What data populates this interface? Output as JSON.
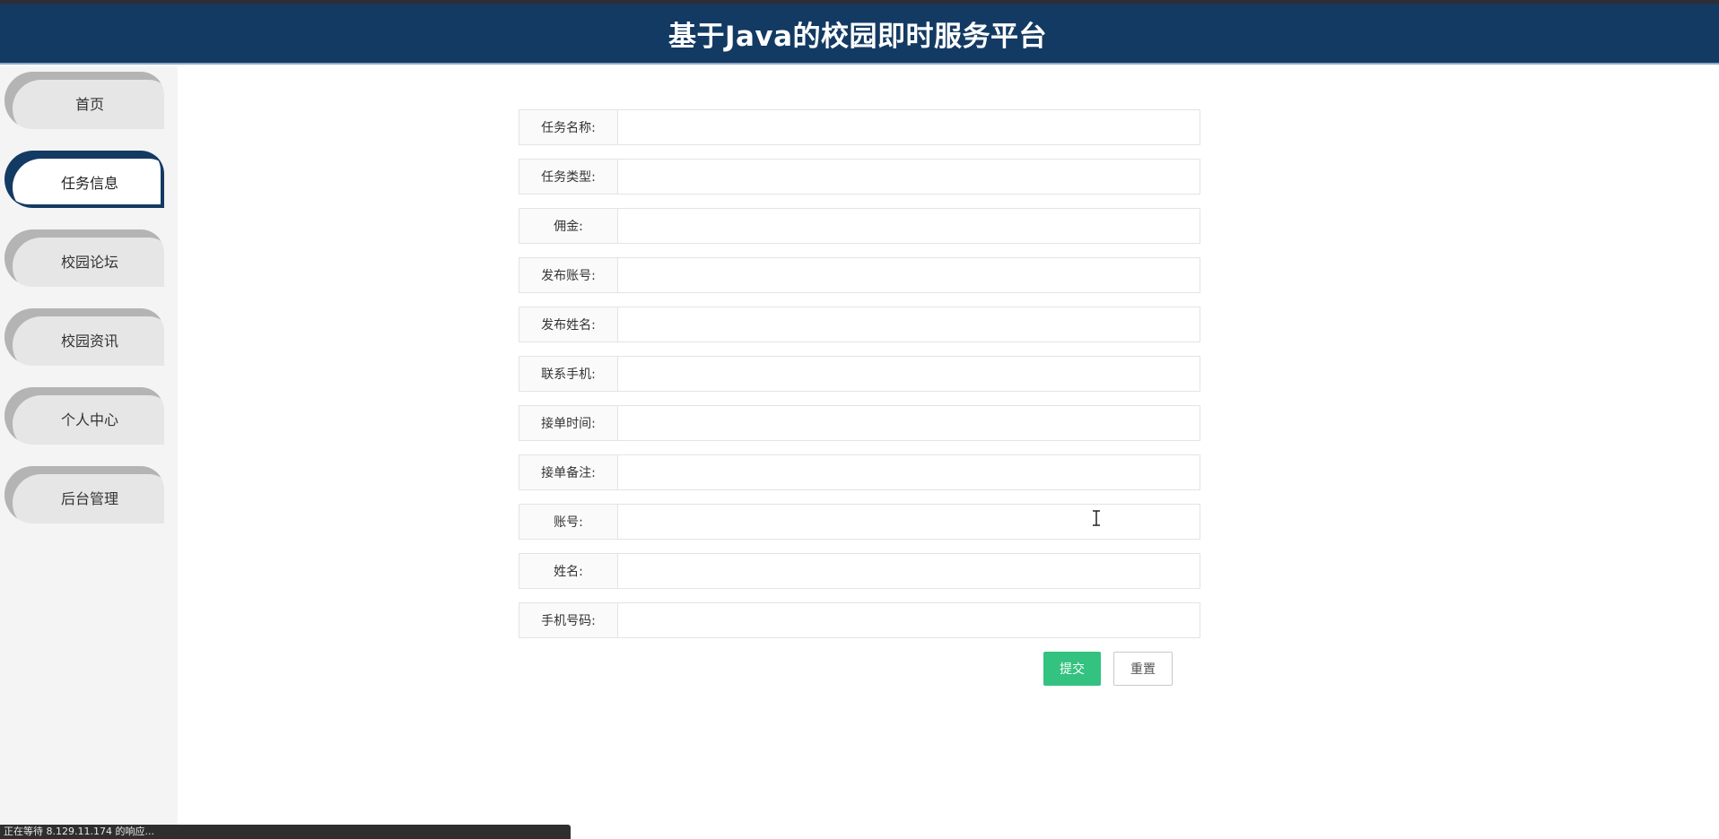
{
  "header": {
    "title": "基于Java的校园即时服务平台"
  },
  "sidebar": {
    "items": [
      {
        "label": "首页"
      },
      {
        "label": "任务信息"
      },
      {
        "label": "校园论坛"
      },
      {
        "label": "校园资讯"
      },
      {
        "label": "个人中心"
      },
      {
        "label": "后台管理"
      }
    ]
  },
  "form": {
    "fields": [
      {
        "label": "任务名称:",
        "value": ""
      },
      {
        "label": "任务类型:",
        "value": ""
      },
      {
        "label": "佣金:",
        "value": ""
      },
      {
        "label": "发布账号:",
        "value": ""
      },
      {
        "label": "发布姓名:",
        "value": ""
      },
      {
        "label": "联系手机:",
        "value": ""
      },
      {
        "label": "接单时间:",
        "value": ""
      },
      {
        "label": "接单备注:",
        "value": ""
      },
      {
        "label": "账号:",
        "value": ""
      },
      {
        "label": "姓名:",
        "value": ""
      },
      {
        "label": "手机号码:",
        "value": ""
      }
    ],
    "submit_label": "提交",
    "reset_label": "重置"
  },
  "status": {
    "text": "正在等待 8.129.11.174 的响应..."
  },
  "colors": {
    "header_bg": "#133a63",
    "submit_bg": "#33c27f",
    "sidebar_bg": "#f4f4f4"
  },
  "icons": {
    "cursor": "text-cursor-icon"
  }
}
